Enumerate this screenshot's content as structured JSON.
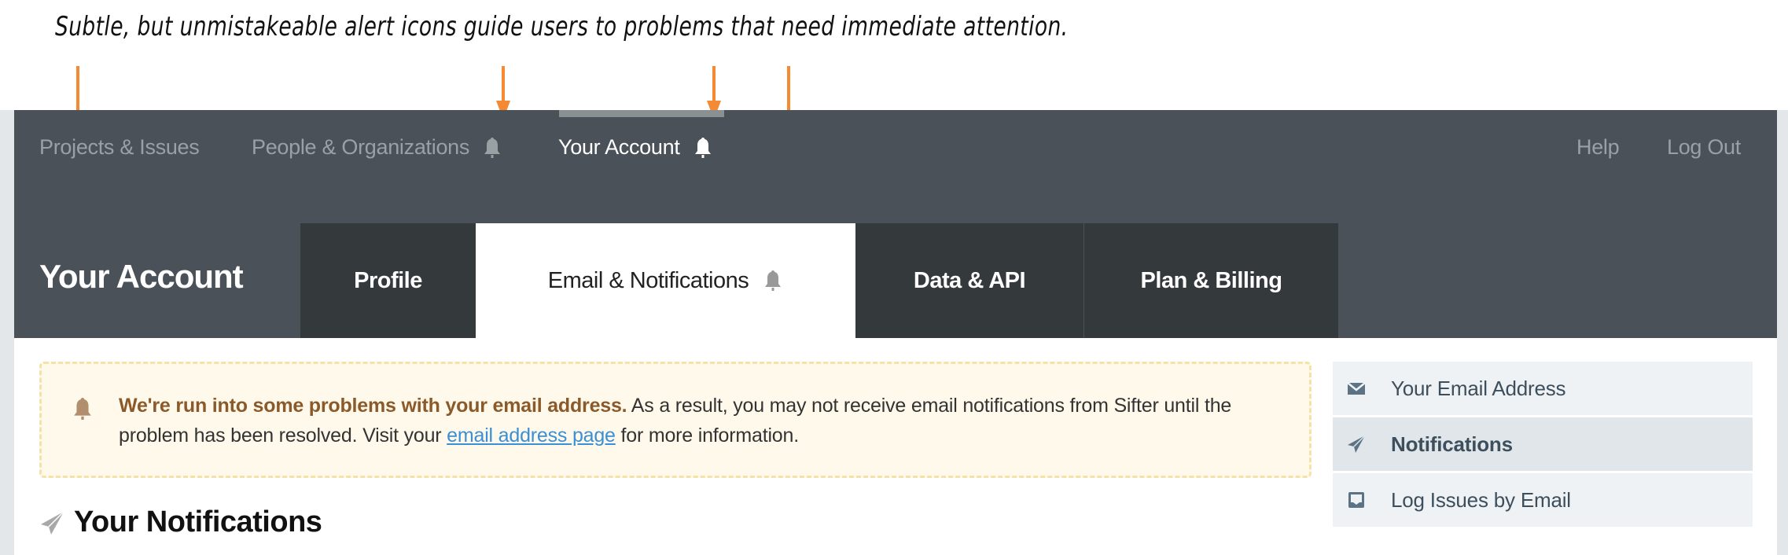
{
  "annotation": {
    "caption": "Subtle, but unmistakeable alert icons guide users to problems that need immediate attention.",
    "accent_color": "#f48a34"
  },
  "topnav": {
    "items": [
      {
        "label": "Projects & Issues",
        "icon": null,
        "active": false
      },
      {
        "label": "People & Organizations",
        "icon": "bell-icon",
        "active": false
      },
      {
        "label": "Your Account",
        "icon": "bell-icon",
        "active": true
      }
    ],
    "right_links": [
      {
        "label": "Help"
      },
      {
        "label": "Log Out"
      }
    ]
  },
  "page": {
    "title": "Your Account"
  },
  "tabs": [
    {
      "label": "Profile",
      "active": false,
      "icon": null
    },
    {
      "label": "Email & Notifications",
      "active": true,
      "icon": "bell-icon"
    },
    {
      "label": "Data & API",
      "active": false,
      "icon": null
    },
    {
      "label": "Plan & Billing",
      "active": false,
      "icon": null
    }
  ],
  "alert": {
    "icon": "bell-icon",
    "strong": "We're run into some problems with your email address.",
    "text_before_link": " As a result, you may not receive email notifications from Sifter until the problem has been resolved. Visit your ",
    "link_label": "email address page",
    "text_after_link": " for more information.",
    "colors": {
      "background": "#fef9ea",
      "border": "#f3e3a8",
      "strong": "#8a5a2b",
      "link": "#3a8fd6"
    }
  },
  "sidebar": {
    "items": [
      {
        "label": "Your Email Address",
        "icon": "envelope-icon",
        "active": false
      },
      {
        "label": "Notifications",
        "icon": "paper-plane-icon",
        "active": true
      },
      {
        "label": "Log Issues by Email",
        "icon": "inbox-icon",
        "active": false
      }
    ]
  },
  "section": {
    "heading": "Your Notifications",
    "icon": "paper-plane-icon"
  }
}
